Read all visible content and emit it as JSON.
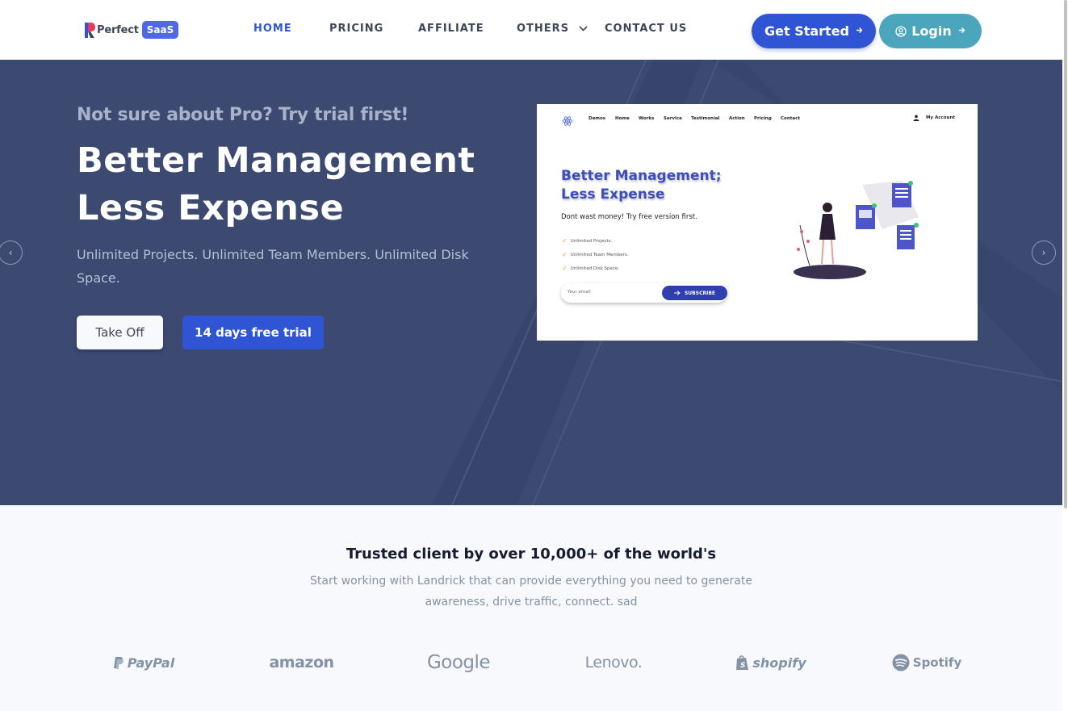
{
  "navbar": {
    "logo_text": "Perfect",
    "logo_badge": "SaaS",
    "links": [
      {
        "label": "HOME",
        "active": true
      },
      {
        "label": "PRICING",
        "active": false
      },
      {
        "label": "AFFILIATE",
        "active": false
      },
      {
        "label": "OTHERS",
        "active": false,
        "has_dropdown": true
      },
      {
        "label": "CONTACT US",
        "active": false
      }
    ],
    "get_started_label": "Get Started",
    "login_label": "Login",
    "arrow_icon": "arrow-right-icon"
  },
  "hero": {
    "subtitle": "Not sure about Pro? Try trial first!",
    "title_line1": "Better Management",
    "title_line2": "Less Expense",
    "description": "Unlimited Projects. Unlimited Team Members. Unlimited Disk Space.",
    "take_off_label": "Take Off",
    "trial_label": "14 days free trial",
    "prev_icon": "chevron-left-icon",
    "next_icon": "chevron-right-icon",
    "prev_glyph": "‹",
    "next_glyph": "›"
  },
  "preview": {
    "nav_links": [
      "Demos",
      "Home",
      "Works",
      "Service",
      "Testimonial",
      "Action",
      "Pricing",
      "Contact"
    ],
    "account_label": "My Account",
    "title_line1": "Better Management;",
    "title_line2": "Less Expense",
    "subtitle": "Dont wast money! Try free version first.",
    "features": [
      "Unlimited Projects.",
      "Unlimited Team Members.",
      "Unlimited Disk Space."
    ],
    "email_placeholder": "Your email",
    "subscribe_label": "SUBSCRIBE"
  },
  "clients": {
    "title": "Trusted client by over 10,000+ of the world's",
    "description": "Start working with Landrick that can provide everything you need to generate awareness, drive traffic, connect. sad",
    "brands": [
      "PayPal",
      "amazon",
      "Google",
      "Lenovo.",
      "shopify",
      "Spotify"
    ]
  },
  "colors": {
    "primary": "#2f55d4",
    "login_button": "#4ba6bd",
    "hero_bg": "#3c4a72",
    "muted": "#8492a6"
  }
}
